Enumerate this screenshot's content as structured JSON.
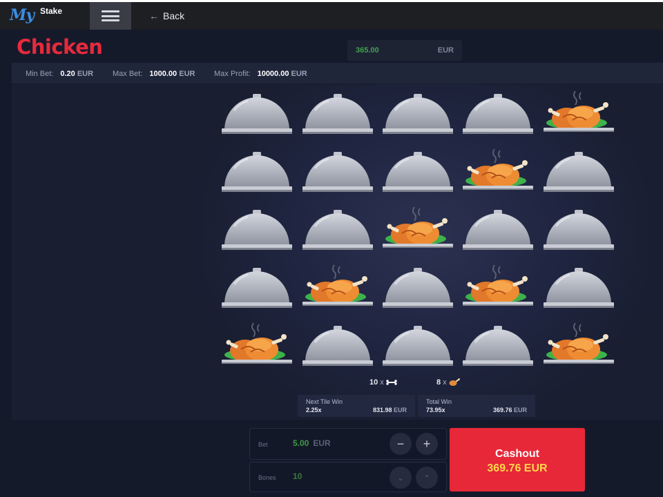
{
  "brand": {
    "logo_my": "My",
    "logo_stake": "Stake"
  },
  "nav": {
    "back_label": "Back"
  },
  "game": {
    "title": "Chicken"
  },
  "balance": {
    "amount": "365.00",
    "currency": "EUR"
  },
  "limits": {
    "min_bet_label": "Min Bet:",
    "min_bet_value": "0.20",
    "min_bet_currency": "EUR",
    "max_bet_label": "Max Bet:",
    "max_bet_value": "1000.00",
    "max_bet_currency": "EUR",
    "max_profit_label": "Max Profit:",
    "max_profit_value": "10000.00",
    "max_profit_currency": "EUR"
  },
  "board": {
    "rows": [
      [
        "cloche",
        "cloche",
        "cloche",
        "cloche",
        "chicken"
      ],
      [
        "cloche",
        "cloche",
        "cloche",
        "chicken",
        "cloche"
      ],
      [
        "cloche",
        "cloche",
        "chicken",
        "cloche",
        "cloche"
      ],
      [
        "cloche",
        "chicken",
        "cloche",
        "chicken",
        "cloche"
      ],
      [
        "chicken",
        "cloche",
        "cloche",
        "cloche",
        "chicken"
      ]
    ],
    "icons": {
      "cloche": "cloche-icon",
      "chicken": "roast-chicken-icon"
    }
  },
  "counts": {
    "bones_count": "10",
    "bones_sep": "x",
    "bones_icon": "bone-icon",
    "chickens_count": "8",
    "chickens_sep": "x",
    "chickens_icon": "chicken-leg-icon"
  },
  "next_tile_win": {
    "title": "Next Tile Win",
    "multiplier": "2.25x",
    "amount": "831.98",
    "currency": "EUR"
  },
  "total_win": {
    "title": "Total Win",
    "multiplier": "73.95x",
    "amount": "369.76",
    "currency": "EUR"
  },
  "bet": {
    "label": "Bet",
    "value": "5.00",
    "currency": "EUR",
    "decrease_symbol": "−",
    "increase_symbol": "+"
  },
  "bones": {
    "label": "Bones",
    "value": "10",
    "down_symbol": "⌄",
    "up_symbol": "⌃"
  },
  "cashout": {
    "label": "Cashout",
    "amount": "369.76",
    "currency": "EUR"
  },
  "colors": {
    "accent_red": "#e72838",
    "title_red": "#e62a3c",
    "win_yellow": "#ffd84a",
    "balance_green": "#3fa34d",
    "background": "#151a2b"
  }
}
